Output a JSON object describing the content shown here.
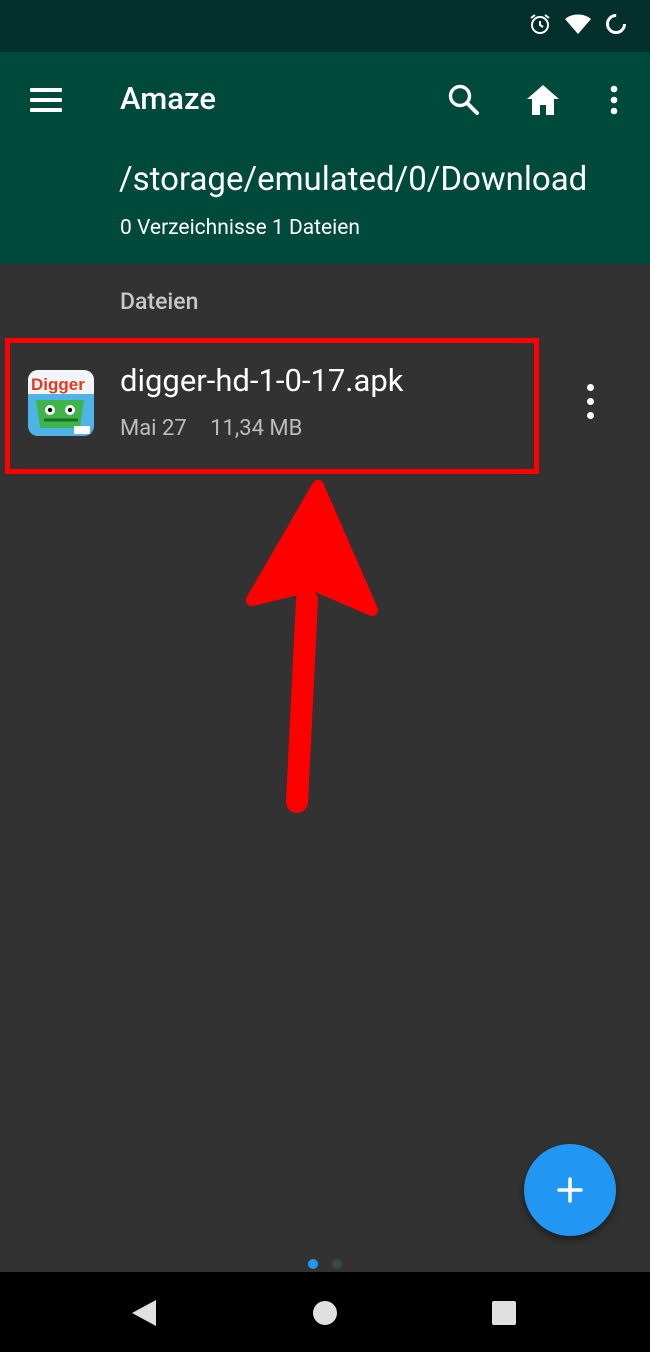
{
  "app": {
    "title": "Amaze"
  },
  "toolbar": {
    "path": "/storage/emulated/0/Download",
    "counts": "0 Verzeichnisse 1 Dateien",
    "icons": [
      "menu-icon",
      "search-icon",
      "home-icon",
      "more-vert-icon"
    ]
  },
  "status_bar": {
    "icons": [
      "alarm-icon",
      "wifi-icon",
      "battery-icon"
    ]
  },
  "files": {
    "section_title": "Dateien",
    "items": [
      {
        "name": "digger-hd-1-0-17.apk",
        "date": "Mai 27",
        "size": "11,34 MB",
        "icon": "digger-hd-app-icon"
      }
    ]
  },
  "annotation": {
    "highlight_color": "#ff0000",
    "arrow_color": "#ff0000"
  },
  "colors": {
    "toolbar": "#004a3c",
    "status_bar": "#03302a",
    "background": "#323232",
    "fab": "#2196f3"
  },
  "pager": {
    "pages": 2,
    "active": 1
  },
  "fab": {
    "icon": "plus-icon"
  },
  "navigation_bar": {
    "icons": [
      "back-icon",
      "home-circle-icon",
      "recents-icon"
    ]
  }
}
